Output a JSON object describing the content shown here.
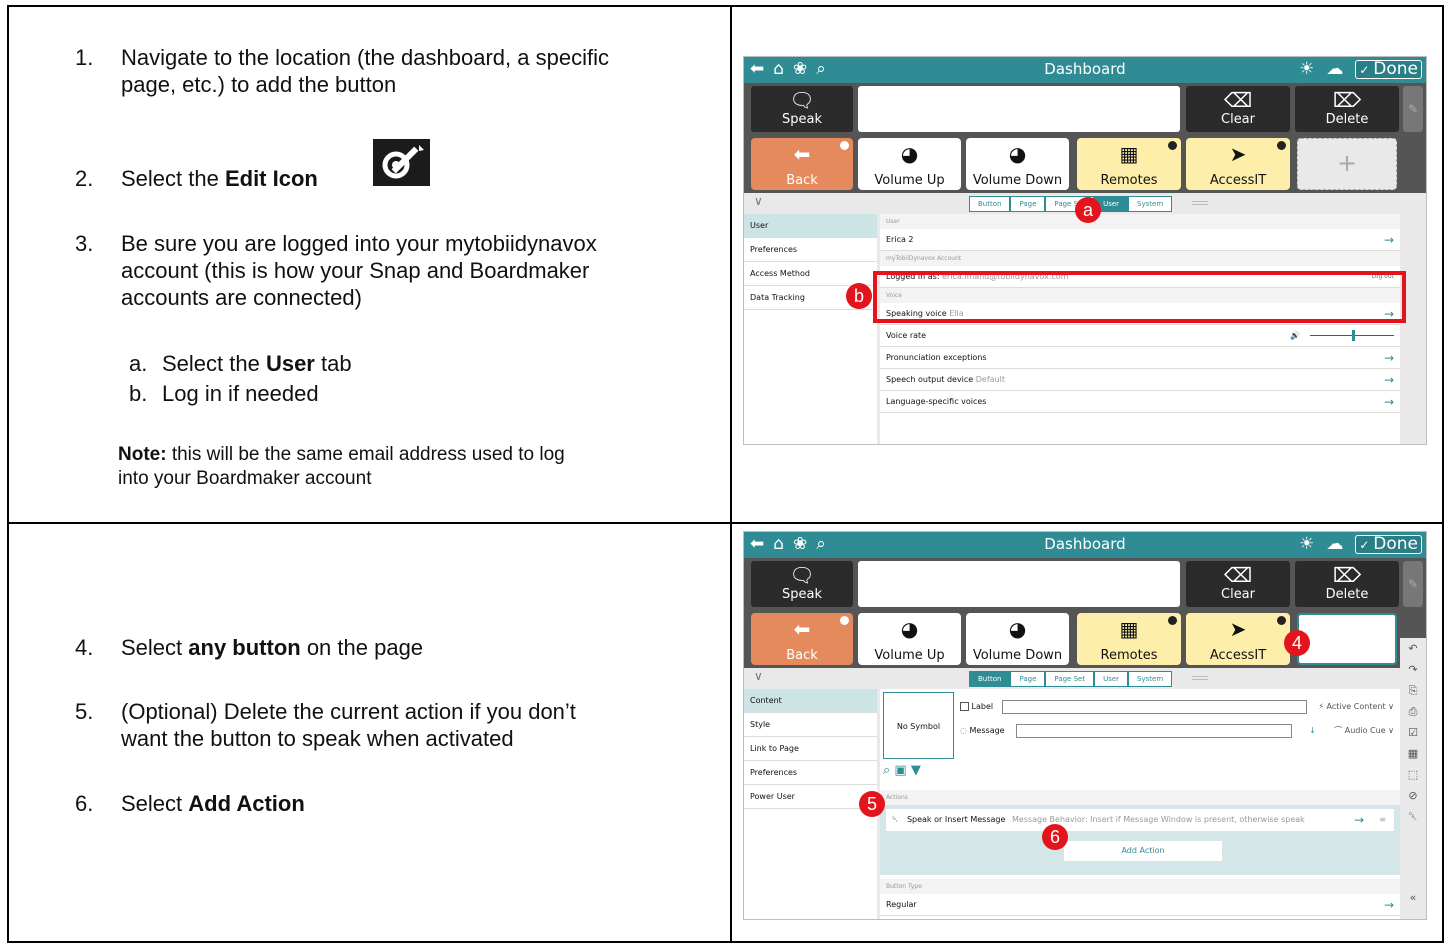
{
  "row1": {
    "steps": [
      {
        "num": "1.",
        "lines": [
          "Navigate to the location (the dashboard, a specific",
          "page, etc.) to add the button"
        ]
      },
      {
        "num": "2.",
        "pre": "Select the ",
        "bold": "Edit Icon"
      },
      {
        "num": "3.",
        "lines": [
          "Be sure you are logged into your mytobiidynavox",
          "account (this is how your Snap and Boardmaker",
          "accounts are connected)"
        ]
      }
    ],
    "substeps": [
      {
        "num": "a.",
        "pre": "Select the ",
        "bold": "User",
        "post": " tab"
      },
      {
        "num": "b.",
        "text": "Log in if needed"
      }
    ],
    "note_label": "Note:",
    "note_line1": " this will be the same email address used to log",
    "note_line2": "into your Boardmaker account"
  },
  "row2": {
    "steps": [
      {
        "num": "4.",
        "pre": "Select ",
        "bold": "any button",
        "post": " on the page"
      },
      {
        "num": "5.",
        "lines": [
          "(Optional) Delete the current action if you don’t",
          "want the button to speak when activated"
        ]
      },
      {
        "num": "6.",
        "pre": "Select ",
        "bold": "Add Action"
      }
    ]
  },
  "snap": {
    "title": "Dashboard",
    "done": "Done",
    "speak": "Speak",
    "clear": "Clear",
    "delete": "Delete",
    "tiles": [
      "Back",
      "Volume Up",
      "Volume Down",
      "Remotes",
      "AccessIT"
    ],
    "tabs": [
      "Button",
      "Page",
      "Page Set",
      "User",
      "System"
    ]
  },
  "shot1": {
    "sidebar": [
      "User",
      "Preferences",
      "Access Method",
      "Data Tracking"
    ],
    "sec_user": "User",
    "user_name": "Erica 2",
    "sec_account": "myTobiiDynavox Account",
    "logged_label": "Logged in as:",
    "email": "erica.iffland@tobiidynavox.com",
    "logout": "Log out",
    "sec_voice": "Voice",
    "speaking_voice": "Speaking voice",
    "speaking_voice_val": "Ella",
    "voice_rate": "Voice rate",
    "pron": "Pronunciation exceptions",
    "speech_out": "Speech output device",
    "speech_out_val": "Default",
    "lang_voices": "Language-specific voices",
    "badge_a": "a",
    "badge_b": "b"
  },
  "shot2": {
    "sidebar": [
      "Content",
      "Style",
      "Link to Page",
      "Preferences",
      "Power User"
    ],
    "no_symbol": "No Symbol",
    "label": "Label",
    "message": "Message",
    "active_content": "Active Content",
    "audio_cue": "Audio Cue",
    "sec_actions": "Actions",
    "action_name": "Speak or Insert Message",
    "action_desc": "Message Behavior: Insert if Message Window is present, otherwise speak",
    "add_action": "Add Action",
    "sec_button_type": "Button Type",
    "regular": "Regular",
    "badge_4": "4",
    "badge_5": "5",
    "badge_6": "6"
  }
}
